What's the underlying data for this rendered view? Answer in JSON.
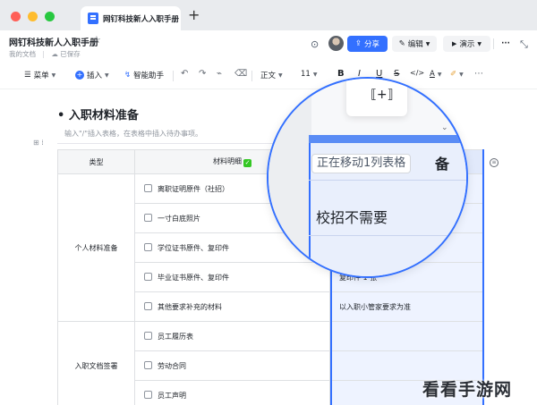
{
  "browser": {
    "tab_title": "网钉科技新人入职手册",
    "new_tab_symbol": "+"
  },
  "doc": {
    "title": "网钉科技新人入职手册",
    "star": "☆",
    "location": "我的文档",
    "save_status": "已保存"
  },
  "header_actions": {
    "share": "分享",
    "edit": "编辑",
    "present": "演示",
    "more": "···"
  },
  "toolbar": {
    "menu": "菜单",
    "insert": "插入",
    "ai": "智能助手",
    "body_style": "正文",
    "font_size": "11",
    "bold": "B",
    "italic": "I",
    "underline": "U",
    "strike": "S",
    "code": "</>",
    "font_color": "A"
  },
  "content": {
    "heading": "入职材料准备",
    "hint": "输入\"/\"插入表格，在表格中插入待办事项。"
  },
  "table": {
    "headers": [
      "类型",
      "材料明细",
      "备注"
    ],
    "groups": [
      {
        "category": "个人材料准备",
        "items": [
          {
            "item": "离职证明原件（社招）",
            "note": ""
          },
          {
            "item": "一寸白底照片",
            "note": ""
          },
          {
            "item": "学位证书原件、复印件",
            "note": ""
          },
          {
            "item": "毕业证书原件、复印件",
            "note": "复印件 1 张"
          },
          {
            "item": "其他要求补充的材料",
            "note": "以入职小管家要求为准"
          }
        ]
      },
      {
        "category": "入职文档签署",
        "items": [
          {
            "item": "员工履历表",
            "note": ""
          },
          {
            "item": "劳动合同",
            "note": ""
          },
          {
            "item": "员工声明",
            "note": ""
          }
        ]
      }
    ]
  },
  "magnifier": {
    "tooltip": "正在移动1列表格",
    "cell_text": "校招不需要",
    "cut_char": "备"
  },
  "watermark": "看看手游网",
  "colors": {
    "accent": "#3370ff",
    "check_green": "#34c724"
  }
}
